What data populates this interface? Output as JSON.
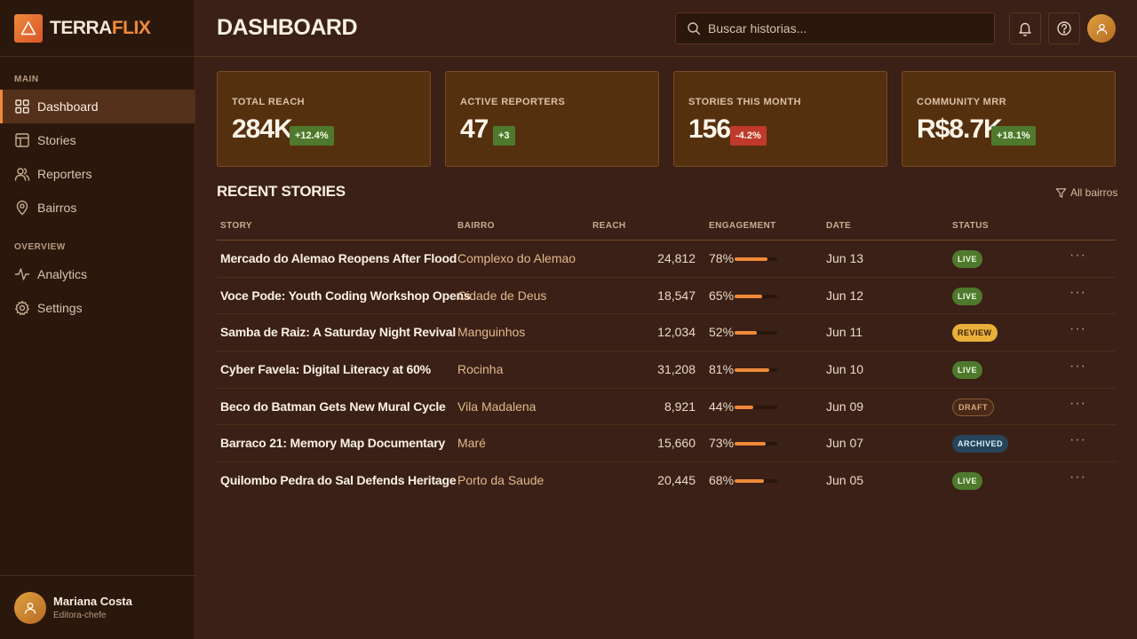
{
  "brand": {
    "part1": "TERRA",
    "part2": "FLIX"
  },
  "sidebar": {
    "main_label": "MAIN",
    "overview_label": "OVERVIEW",
    "main_items": [
      {
        "label": "Dashboard",
        "icon": "grid-icon",
        "active": true
      },
      {
        "label": "Stories",
        "icon": "layout-icon"
      },
      {
        "label": "Reporters",
        "icon": "users-icon"
      },
      {
        "label": "Bairros",
        "icon": "map-pin-icon"
      }
    ],
    "overview_items": [
      {
        "label": "Analytics",
        "icon": "activity-icon"
      },
      {
        "label": "Settings",
        "icon": "gear-icon"
      }
    ],
    "user": {
      "name": "Mariana Costa",
      "role": "Editora-chefe"
    }
  },
  "header": {
    "title": "DASHBOARD",
    "search_placeholder": "Buscar historias..."
  },
  "kpis": [
    {
      "label": "TOTAL REACH",
      "value": "284K",
      "delta": "+12.4%",
      "trend": "up"
    },
    {
      "label": "ACTIVE REPORTERS",
      "value": "47",
      "delta": "+3",
      "trend": "up"
    },
    {
      "label": "STORIES THIS MONTH",
      "value": "156",
      "delta": "-4.2%",
      "trend": "down"
    },
    {
      "label": "COMMUNITY MRR",
      "value": "R$8.7K",
      "delta": "+18.1%",
      "trend": "up"
    }
  ],
  "recent": {
    "title": "RECENT STORIES",
    "filter_label": "All bairros",
    "columns": [
      "STORY",
      "BAIRRO",
      "REACH",
      "ENGAGEMENT",
      "DATE",
      "STATUS"
    ],
    "rows": [
      {
        "story": "Mercado do Alemao Reopens After Flood",
        "bairro": "Complexo do Alemao",
        "reach": "24,812",
        "engagement": "78%",
        "engagement_value": 78,
        "date": "Jun 13",
        "status": "LIVE"
      },
      {
        "story": "Voce Pode: Youth Coding Workshop Opens",
        "bairro": "Cidade de Deus",
        "reach": "18,547",
        "engagement": "65%",
        "engagement_value": 65,
        "date": "Jun 12",
        "status": "LIVE"
      },
      {
        "story": "Samba de Raiz: A Saturday Night Revival",
        "bairro": "Manguinhos",
        "reach": "12,034",
        "engagement": "52%",
        "engagement_value": 52,
        "date": "Jun 11",
        "status": "REVIEW"
      },
      {
        "story": "Cyber Favela: Digital Literacy at 60%",
        "bairro": "Rocinha",
        "reach": "31,208",
        "engagement": "81%",
        "engagement_value": 81,
        "date": "Jun 10",
        "status": "LIVE"
      },
      {
        "story": "Beco do Batman Gets New Mural Cycle",
        "bairro": "Vila Madalena",
        "reach": "8,921",
        "engagement": "44%",
        "engagement_value": 44,
        "date": "Jun 09",
        "status": "DRAFT"
      },
      {
        "story": "Barraco 21: Memory Map Documentary",
        "bairro": "Maré",
        "reach": "15,660",
        "engagement": "73%",
        "engagement_value": 73,
        "date": "Jun 07",
        "status": "ARCHIVED"
      },
      {
        "story": "Quilombo Pedra do Sal Defends Heritage",
        "bairro": "Porto da Saude",
        "reach": "20,445",
        "engagement": "68%",
        "engagement_value": 68,
        "date": "Jun 05",
        "status": "LIVE"
      }
    ]
  },
  "colors": {
    "accent": "#f08a3a",
    "live": "#4f7a2d",
    "review": "#e8b039",
    "archived": "#26455b",
    "negative": "#c0392b"
  }
}
